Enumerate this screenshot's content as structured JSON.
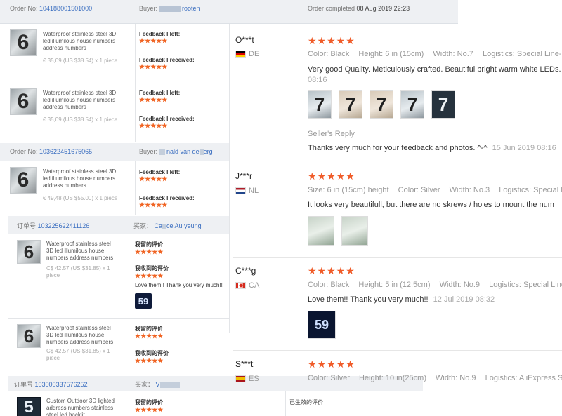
{
  "orders": [
    {
      "order_no_label": "Order No:",
      "order_no": "104188001501000",
      "buyer_label": "Buyer:",
      "buyer_name": "rooten",
      "completed_label": "Order completed",
      "completed_date": "08 Aug 2019 22:23",
      "items": [
        {
          "thumb": "6",
          "title": "Waterproof stainless steel 3D led illumilous house numbers address numbers",
          "price": "€ 35,09 (US $38.54) x 1 piece",
          "fb_left_label": "Feedback I left:",
          "fb_received_label": "Feedback I received:",
          "stars_left": "★★★★★",
          "stars_received": "★★★★★"
        },
        {
          "thumb": "6",
          "title": "Waterproof stainless steel 3D led illumilous house numbers address numbers",
          "price": "€ 35,09 (US $38.54) x 1 piece",
          "fb_left_label": "Feedback I left:",
          "fb_received_label": "Feedback I received:",
          "stars_left": "★★★★★",
          "stars_received": "★★★★★"
        }
      ]
    },
    {
      "order_no_label": "Order No:",
      "order_no": "103622451675065",
      "buyer_label": "Buyer:",
      "buyer_name": "nald van de",
      "buyer_name_tail": "erg",
      "items": [
        {
          "thumb": "6",
          "title": "Waterproof stainless steel 3D led illumilous house numbers address numbers",
          "price": "€ 49,48 (US $55.00) x 1 piece",
          "fb_left_label": "Feedback I left:",
          "fb_received_label": "Feedback I received:",
          "stars_left": "★★★★★",
          "stars_received": "★★★★★"
        }
      ]
    },
    {
      "order_no_label": "订单号",
      "order_no": "103225622411126",
      "buyer_label": "买家：",
      "buyer_name": "Ca",
      "buyer_name_tail": "ce Au yeung",
      "items": [
        {
          "thumb": "6",
          "title": "Waterproof stainless steel 3D led illumilous house numbers address numbers",
          "price": "C$ 42.57 (US $31.85) x 1 piece",
          "fb_left_label": "我留的评价",
          "fb_received_label": "我收到的评价",
          "stars_left": "★★★★★",
          "stars_received": "★★★★★",
          "comment": "Love them!! Thank you very much!!",
          "photo": "59"
        },
        {
          "thumb": "6",
          "title": "Waterproof stainless steel 3D led illumilous house numbers address numbers",
          "price": "C$ 42.57 (US $31.85) x 1 piece",
          "fb_left_label": "我留的评价",
          "fb_received_label": "我收到的评价",
          "stars_left": "★★★★★",
          "stars_received": "★★★★★"
        }
      ]
    },
    {
      "order_no_label": "订单号",
      "order_no": "103000337576252",
      "buyer_label": "买家：",
      "buyer_name": "V",
      "items": [
        {
          "thumb": "5",
          "title": "Custom Outdoor 3D lighted address numbers stainless steel led backlit",
          "fb_left_label": "我留的评价",
          "stars_left": "★★★★★",
          "extra": "已生效的评价"
        }
      ]
    }
  ],
  "reviews": [
    {
      "name": "O***t",
      "country": "DE",
      "flag": "de",
      "stars": "★★★★★",
      "meta": [
        {
          "k": "Color:",
          "v": "Black"
        },
        {
          "k": "Height:",
          "v": "6 in (15cm)"
        },
        {
          "k": "Width:",
          "v": "No.7"
        },
        {
          "k": "Logistics:",
          "v": "Special Line-YW"
        }
      ],
      "text": "Very good Quality. Meticulously crafted. Beautiful bright warm white LEDs.",
      "date": "08:16",
      "photos": [
        "7",
        "7",
        "7",
        "7",
        "7"
      ],
      "seller_label": "Seller's Reply",
      "seller_text": "Thanks very much for your feedback and photos. ^-^",
      "seller_date": "15 Jun 2019 08:16"
    },
    {
      "name": "J***r",
      "country": "NL",
      "flag": "nl",
      "stars": "★★★★★",
      "meta": [
        {
          "k": "Size:",
          "v": "6 in (15cm) height"
        },
        {
          "k": "Color:",
          "v": "Silver"
        },
        {
          "k": "Width:",
          "v": "No.3"
        },
        {
          "k": "Logistics:",
          "v": "Special Lin"
        }
      ],
      "text": "It looks very beautifull, but there are no skrews / holes to mount the num",
      "photos": [
        "",
        ""
      ]
    },
    {
      "name": "C***g",
      "country": "CA",
      "flag": "ca",
      "stars": "★★★★★",
      "meta": [
        {
          "k": "Color:",
          "v": "Black"
        },
        {
          "k": "Height:",
          "v": "5 in (12.5cm)"
        },
        {
          "k": "Width:",
          "v": "No.9"
        },
        {
          "k": "Logistics:",
          "v": "Special Line-"
        }
      ],
      "text": "Love them!! Thank you very much!!",
      "date": "12 Jul 2019 08:32",
      "photos": [
        "59"
      ]
    },
    {
      "name": "S***t",
      "country": "ES",
      "flag": "es",
      "stars": "★★★★★",
      "meta": [
        {
          "k": "Color:",
          "v": "Silver"
        },
        {
          "k": "Height:",
          "v": "10 in(25cm)"
        },
        {
          "k": "Width:",
          "v": "No.9"
        },
        {
          "k": "Logistics:",
          "v": "AliExpress Sta"
        }
      ]
    }
  ]
}
